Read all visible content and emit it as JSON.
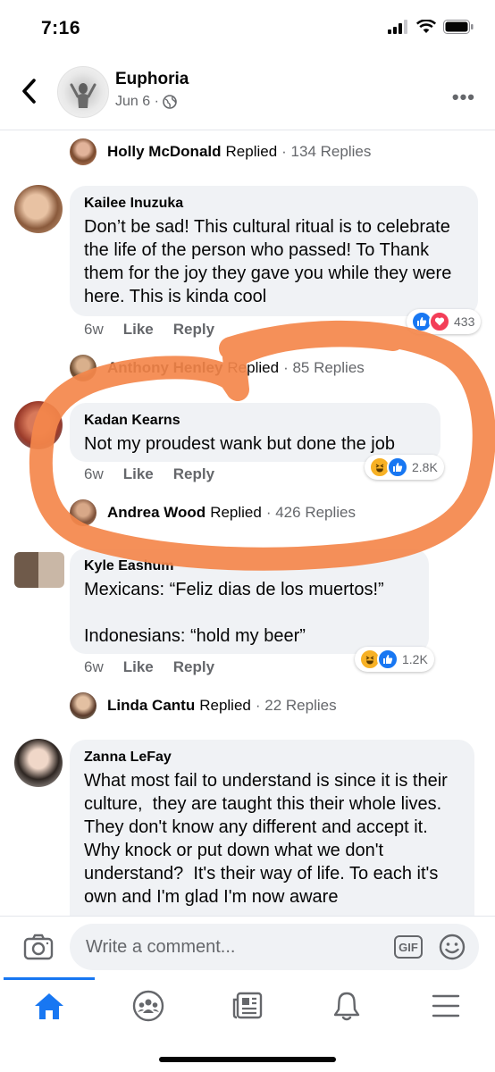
{
  "status_bar": {
    "time": "7:16"
  },
  "header": {
    "group_name": "Euphoria",
    "date": "Jun 6 ·"
  },
  "reply_rows": [
    {
      "name": "Holly McDonald",
      "verb": "Replied",
      "count": "· 134 Replies"
    },
    {
      "name": "Anthony Henley",
      "verb": "Replied",
      "count": "· 85 Replies"
    },
    {
      "name": "Andrea Wood",
      "verb": "Replied",
      "count": "· 426 Replies"
    },
    {
      "name": "Linda Cantu",
      "verb": "Replied",
      "count": "· 22 Replies"
    }
  ],
  "comments": [
    {
      "name": "Kailee Inuzuka",
      "text": "Don’t be sad! This cultural ritual is to celebrate the life of the person who passed! To Thank them for the joy they gave you while they were here. This is kinda cool",
      "time": "6w",
      "like": "Like",
      "reply": "Reply",
      "reactions": [
        "like",
        "love"
      ],
      "reaction_count": "433"
    },
    {
      "name": "Kadan Kearns",
      "text": "Not my proudest wank but done the job",
      "time": "6w",
      "like": "Like",
      "reply": "Reply",
      "reactions": [
        "haha",
        "like"
      ],
      "reaction_count": "2.8K"
    },
    {
      "name": "Kyle Eashum",
      "text": "Mexicans: “Feliz dias de los muertos!”\n\nIndonesians: “hold my beer”",
      "time": "6w",
      "like": "Like",
      "reply": "Reply",
      "reactions": [
        "haha",
        "like"
      ],
      "reaction_count": "1.2K"
    },
    {
      "name": "Zanna LeFay",
      "text": "What most fail to understand is since it is their culture,  they are taught this their whole lives. They don't know any different and accept it. Why knock or put down what we don't understand?  It's their way of life. To each it's own and I'm glad I'm now aware"
    }
  ],
  "composer": {
    "placeholder": "Write a comment...",
    "gif_label": "GIF"
  },
  "tabs": [
    "home-icon",
    "groups-icon",
    "news-icon",
    "notifications-icon",
    "menu-icon"
  ],
  "colors": {
    "accent": "#1877f2",
    "annotation": "#f4874b",
    "bubble": "#f0f2f5",
    "love": "#f33e58",
    "haha": "#f7b125"
  }
}
